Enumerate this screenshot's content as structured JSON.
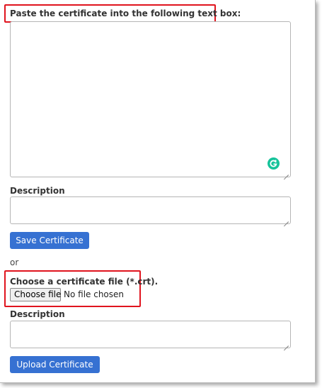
{
  "paste_section": {
    "label": "Paste the certificate into the following text box:",
    "certificate_value": ""
  },
  "description_1": {
    "label": "Description",
    "value": ""
  },
  "save_button": {
    "label": "Save Certificate"
  },
  "separator": {
    "text": "or"
  },
  "file_section": {
    "label": "Choose a certificate file (*.crt).",
    "choose_button": "Choose file",
    "file_status": "No file chosen"
  },
  "description_2": {
    "label": "Description",
    "value": ""
  },
  "upload_button": {
    "label": "Upload Certificate"
  },
  "icons": {
    "grammarly": "grammarly-icon"
  },
  "colors": {
    "button_primary": "#3671d2",
    "highlight_border": "#e0141e",
    "grammarly_green": "#15c39a"
  }
}
